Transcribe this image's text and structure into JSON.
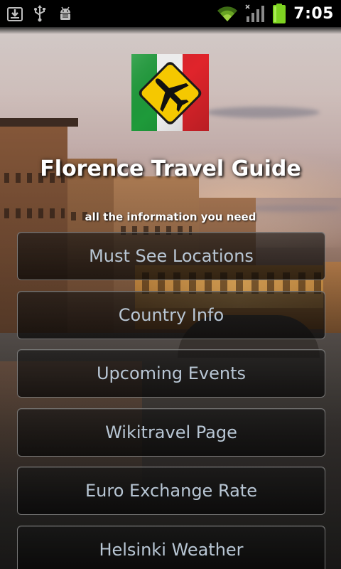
{
  "status_bar": {
    "time": "7:05",
    "left_icons": [
      "download-icon",
      "usb-icon",
      "android-debug-icon"
    ],
    "right_icons": [
      "wifi-icon",
      "signal-icon",
      "battery-icon"
    ],
    "battery_color": "#7ed321"
  },
  "app": {
    "title": "Florence Travel Guide",
    "subtitle": "all the information you need",
    "logo": {
      "icon": "airplane-sign-icon",
      "flag_colors": [
        "#1e9a3a",
        "#ffffff",
        "#e0242b"
      ],
      "sign_color": "#f5c800"
    },
    "accent_text_color": "#b8c6d4"
  },
  "menu": {
    "items": [
      {
        "label": "Must See Locations"
      },
      {
        "label": "Country Info"
      },
      {
        "label": "Upcoming Events"
      },
      {
        "label": "Wikitravel Page"
      },
      {
        "label": "Euro Exchange Rate"
      },
      {
        "label": "Helsinki Weather"
      }
    ]
  }
}
